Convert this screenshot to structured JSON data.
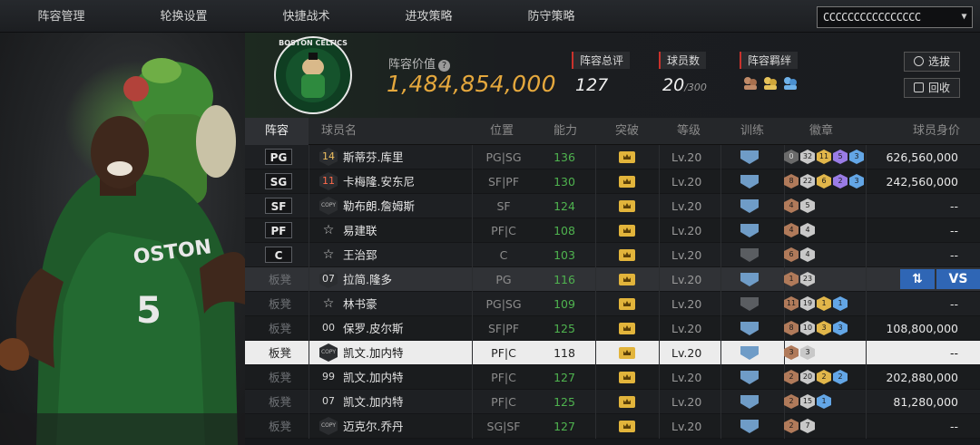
{
  "tabs": [
    {
      "label": "阵容管理",
      "active": true
    },
    {
      "label": "轮换设置",
      "active": false
    },
    {
      "label": "快捷战术",
      "active": false
    },
    {
      "label": "进攻策略",
      "active": false
    },
    {
      "label": "防守策略",
      "active": false
    }
  ],
  "account": {
    "value": "CCCCCCCCCCCCCCCC"
  },
  "team": {
    "logo_text": "BOSTON CELTICS"
  },
  "lineup_value": {
    "label": "阵容价值",
    "help_icon": "?",
    "value": "1,484,854,000"
  },
  "stats": {
    "rating_label": "阵容总评",
    "rating_value": "127",
    "players_label": "球员数",
    "players_value": "20",
    "players_max": "/300",
    "bonds_label": "阵容羁绊"
  },
  "buttons": {
    "pick": "选拔",
    "recycle": "回收"
  },
  "table": {
    "headers": {
      "lineup": "阵容",
      "name": "球员名",
      "position": "位置",
      "ability": "能力",
      "breakthrough": "突破",
      "level": "等级",
      "training": "训练",
      "badges": "徽章",
      "worth": "球员身价"
    },
    "rows": [
      {
        "slot": "PG",
        "jersey": "14",
        "jersey_style": "gold",
        "name": "斯蒂芬.库里",
        "position": "PG|SG",
        "ability": "136",
        "level": "Lv.20",
        "train": "blue",
        "badges": [
          {
            "c": "gr",
            "t": "0"
          },
          {
            "c": "si",
            "t": "32"
          },
          {
            "c": "go",
            "t": "11"
          },
          {
            "c": "pu",
            "t": "5"
          },
          {
            "c": "bl",
            "t": "3"
          }
        ],
        "worth": "626,560,000"
      },
      {
        "slot": "SG",
        "jersey": "11",
        "jersey_style": "red",
        "name": "卡梅隆.安东尼",
        "position": "SF|PF",
        "ability": "130",
        "level": "Lv.20",
        "train": "blue",
        "badges": [
          {
            "c": "br",
            "t": "8"
          },
          {
            "c": "si",
            "t": "22"
          },
          {
            "c": "go",
            "t": "6"
          },
          {
            "c": "pu",
            "t": "2"
          },
          {
            "c": "bl",
            "t": "3"
          }
        ],
        "worth": "242,560,000"
      },
      {
        "slot": "SF",
        "jersey": "COPY",
        "jersey_style": "copy",
        "name": "勒布朗.詹姆斯",
        "position": "SF",
        "ability": "124",
        "level": "Lv.20",
        "train": "blue",
        "badges": [
          {
            "c": "br",
            "t": "4"
          },
          {
            "c": "si",
            "t": "5"
          }
        ],
        "worth": "--"
      },
      {
        "slot": "PF",
        "jersey": "☆",
        "jersey_style": "star",
        "name": "易建联",
        "position": "PF|C",
        "ability": "108",
        "level": "Lv.20",
        "train": "blue",
        "badges": [
          {
            "c": "br",
            "t": "4"
          },
          {
            "c": "si",
            "t": "4"
          }
        ],
        "worth": "--"
      },
      {
        "slot": "C",
        "jersey": "☆",
        "jersey_style": "star",
        "name": "王治郅",
        "position": "C",
        "ability": "103",
        "level": "Lv.20",
        "train": "gray",
        "badges": [
          {
            "c": "br",
            "t": "6"
          },
          {
            "c": "si",
            "t": "4"
          }
        ],
        "worth": "--"
      },
      {
        "slot": "板凳",
        "jersey": "07",
        "jersey_style": "hex",
        "name": "拉简.隆多",
        "position": "PG",
        "ability": "116",
        "level": "Lv.20",
        "train": "blue",
        "badges": [
          {
            "c": "br",
            "t": "1"
          },
          {
            "c": "si",
            "t": "23"
          }
        ],
        "worth": "",
        "vs": true
      },
      {
        "slot": "板凳",
        "jersey": "☆",
        "jersey_style": "star",
        "name": "林书豪",
        "position": "PG|SG",
        "ability": "109",
        "level": "Lv.20",
        "train": "gray",
        "badges": [
          {
            "c": "br",
            "t": "11"
          },
          {
            "c": "si",
            "t": "19"
          },
          {
            "c": "go",
            "t": "1"
          },
          {
            "c": "bl",
            "t": "1"
          }
        ],
        "worth": "--"
      },
      {
        "slot": "板凳",
        "jersey": "00",
        "jersey_style": "plain",
        "name": "保罗.皮尔斯",
        "position": "SF|PF",
        "ability": "125",
        "level": "Lv.20",
        "train": "blue",
        "badges": [
          {
            "c": "br",
            "t": "8"
          },
          {
            "c": "si",
            "t": "10"
          },
          {
            "c": "go",
            "t": "3"
          },
          {
            "c": "bl",
            "t": "3"
          }
        ],
        "worth": "108,800,000"
      },
      {
        "slot": "板凳",
        "jersey": "COPY",
        "jersey_style": "copy",
        "name": "凯文.加内特",
        "position": "PF|C",
        "ability": "118",
        "level": "Lv.20",
        "train": "blue",
        "badges": [
          {
            "c": "br",
            "t": "3"
          },
          {
            "c": "si",
            "t": "3"
          }
        ],
        "worth": "--",
        "selected": true
      },
      {
        "slot": "板凳",
        "jersey": "99",
        "jersey_style": "plain",
        "name": "凯文.加内特",
        "position": "PF|C",
        "ability": "127",
        "level": "Lv.20",
        "train": "blue",
        "badges": [
          {
            "c": "br",
            "t": "2"
          },
          {
            "c": "si",
            "t": "20"
          },
          {
            "c": "go",
            "t": "2"
          },
          {
            "c": "bl",
            "t": "2"
          }
        ],
        "worth": "202,880,000"
      },
      {
        "slot": "板凳",
        "jersey": "07",
        "jersey_style": "plain",
        "name": "凯文.加内特",
        "position": "PF|C",
        "ability": "125",
        "level": "Lv.20",
        "train": "blue",
        "badges": [
          {
            "c": "br",
            "t": "2"
          },
          {
            "c": "si",
            "t": "15"
          },
          {
            "c": "bl",
            "t": "1"
          }
        ],
        "worth": "81,280,000"
      },
      {
        "slot": "板凳",
        "jersey": "COPY",
        "jersey_style": "copy",
        "name": "迈克尔.乔丹",
        "position": "SG|SF",
        "ability": "127",
        "level": "Lv.20",
        "train": "blue",
        "badges": [
          {
            "c": "br",
            "t": "2"
          },
          {
            "c": "si",
            "t": "7"
          }
        ],
        "worth": "--"
      }
    ]
  },
  "vs": {
    "swap": "⇅",
    "label": "VS"
  },
  "colors": {
    "accent": "#e3a63b",
    "ability_green": "#4fb34f",
    "stat_marker": "#c9322c",
    "vs_blue": "#2f66b5"
  }
}
